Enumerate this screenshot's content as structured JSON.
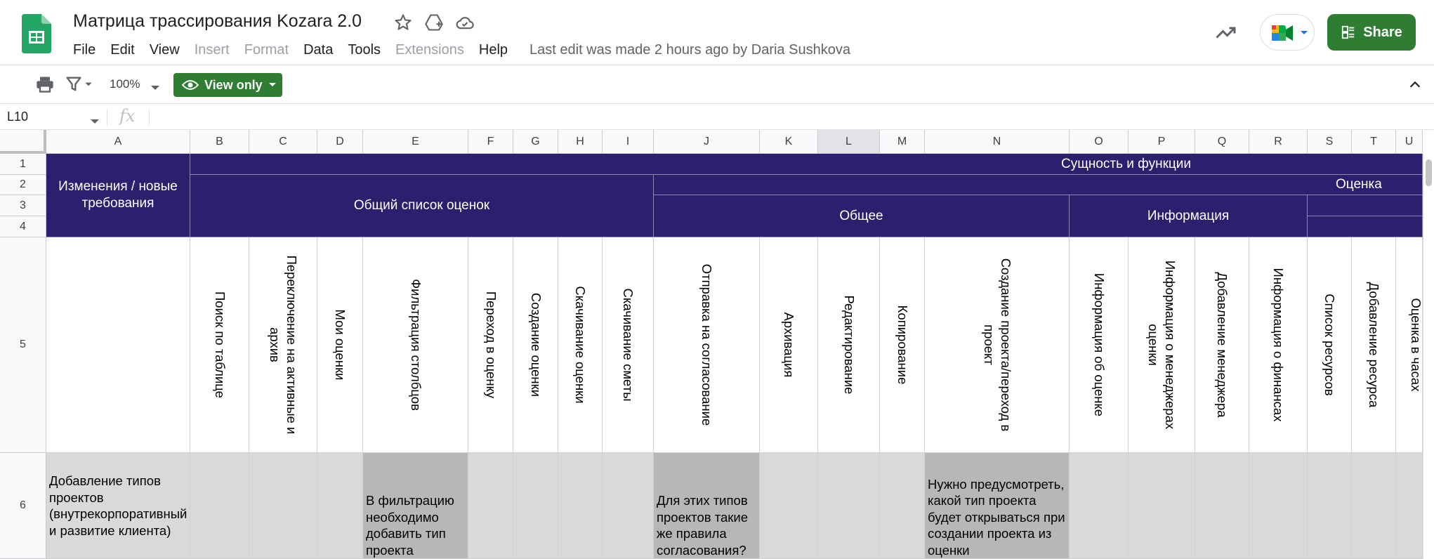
{
  "header": {
    "doc_title": "Матрица трассирования Kozara 2.0",
    "menu": [
      {
        "label": "File",
        "enabled": true
      },
      {
        "label": "Edit",
        "enabled": true
      },
      {
        "label": "View",
        "enabled": true
      },
      {
        "label": "Insert",
        "enabled": false
      },
      {
        "label": "Format",
        "enabled": false
      },
      {
        "label": "Data",
        "enabled": true
      },
      {
        "label": "Tools",
        "enabled": true
      },
      {
        "label": "Extensions",
        "enabled": false
      },
      {
        "label": "Help",
        "enabled": true
      }
    ],
    "last_edit": "Last edit was made 2 hours ago by Daria Sushkova",
    "share_label": "Share"
  },
  "toolbar": {
    "zoom": "100%",
    "view_only_label": "View only"
  },
  "formula_bar": {
    "name_box": "L10",
    "fx_symbol": "fx",
    "content": ""
  },
  "sheet": {
    "columns": [
      "A",
      "B",
      "C",
      "D",
      "E",
      "F",
      "G",
      "H",
      "I",
      "J",
      "K",
      "L",
      "M",
      "N",
      "O",
      "P",
      "Q",
      "R",
      "S",
      "T",
      "U"
    ],
    "selected_column": "L",
    "rows": [
      "1",
      "2",
      "3",
      "4",
      "5",
      "6"
    ],
    "headers": {
      "changes": "Изменения / новые требования",
      "entity": "Сущность и функции",
      "general_list": "Общий список оценок",
      "estimate": "Оценка",
      "general": "Общее",
      "info": "Информация"
    },
    "functions": {
      "B": "Поиск по таблице",
      "C": "Переключение на активные и архив",
      "D": "Мои оценки",
      "E": "Фильтрация столбцов",
      "F": "Переход в оценку",
      "G": "Создание  оценки",
      "H": "Скачивание оценки",
      "I": "Скачивание сметы",
      "J": "Отправка на согласование",
      "K": "Архивация",
      "L": "Редактирование",
      "M": "Копирование",
      "N": "Создание проекта/переход в проект",
      "O": "Информация об оценке",
      "P": "Информация о менеджерах оценки",
      "Q": "Добавление менеджера",
      "R": "Информация о финансах",
      "S": "Список ресурсов",
      "T": "Добавление ресурса",
      "U": "Оценка в часах"
    },
    "row6": {
      "A": "Добавление типов проектов (внутрекорпоративный и развитие клиента)",
      "E": "В фильтрацию необходимо добавить тип проекта",
      "J": "Для этих типов проектов такие же правила согласования?",
      "N": "Нужно предусмотреть, какой тип проекта будет открываться при создании проекта из оценки"
    }
  },
  "colors": {
    "header_navy": "#2e1e6e",
    "share_green": "#2f7d32",
    "cell_gray": "#d9d9d9",
    "cell_dark_gray": "#b7b7b7"
  }
}
